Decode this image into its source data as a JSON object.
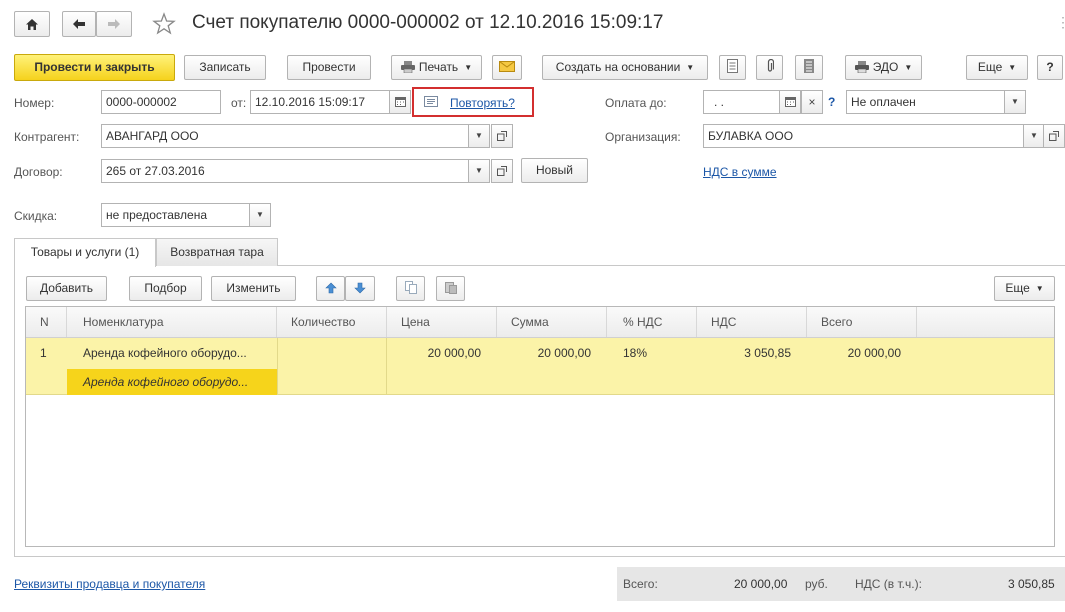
{
  "title": "Счет покупателю 0000-000002 от 12.10.2016 15:09:17",
  "toolbar": {
    "post_close": "Провести и закрыть",
    "save": "Записать",
    "post": "Провести",
    "print": "Печать",
    "create_based": "Создать на основании",
    "edo": "ЭДО",
    "more": "Еще",
    "help": "?"
  },
  "form": {
    "number_label": "Номер:",
    "number": "0000-000002",
    "from_label": "от:",
    "date": "12.10.2016 15:09:17",
    "repeat_link": "Повторять?",
    "payment_label": "Оплата до:",
    "payment_date": " .  .",
    "clear": "×",
    "q": "?",
    "status": "Не оплачен",
    "contractor_label": "Контрагент:",
    "contractor": "АВАНГАРД ООО",
    "org_label": "Организация:",
    "org": "БУЛАВКА ООО",
    "contract_label": "Договор:",
    "contract": "265 от 27.03.2016",
    "new_btn": "Новый",
    "vat_link": "НДС в сумме",
    "discount_label": "Скидка:",
    "discount": "не предоставлена"
  },
  "tabs": [
    "Товары и услуги (1)",
    "Возвратная тара"
  ],
  "table_toolbar": {
    "add": "Добавить",
    "pick": "Подбор",
    "edit": "Изменить",
    "more": "Еще"
  },
  "table": {
    "headers": [
      "N",
      "Номенклатура",
      "Количество",
      "Цена",
      "Сумма",
      "% НДС",
      "НДС",
      "Всего"
    ],
    "rows": [
      {
        "n": "1",
        "item": "Аренда кофейного оборудо...",
        "item_sub": "Аренда кофейного оборудо...",
        "qty": "",
        "price": "20 000,00",
        "sum": "20 000,00",
        "vat_rate": "18%",
        "vat": "3 050,85",
        "total": "20 000,00"
      }
    ]
  },
  "footer": {
    "requisites_link": "Реквизиты продавца и покупателя",
    "total_label": "Всего:",
    "total": "20 000,00",
    "currency": "руб.",
    "vat_label": "НДС (в т.ч.):",
    "vat": "3 050,85"
  },
  "colors": {
    "accent_yellow": "#f5d21c",
    "row_highlight": "#fbf3a8",
    "link": "#1c57a7",
    "outline_red": "#d32f2f"
  }
}
